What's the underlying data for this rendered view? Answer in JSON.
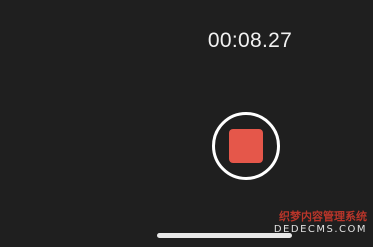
{
  "recorder": {
    "elapsed_time": "00:08.27",
    "stop_button_color": "#e5574a"
  },
  "watermark": {
    "line1": "织梦内容管理系统",
    "line2": "DEDECMS.COM"
  }
}
